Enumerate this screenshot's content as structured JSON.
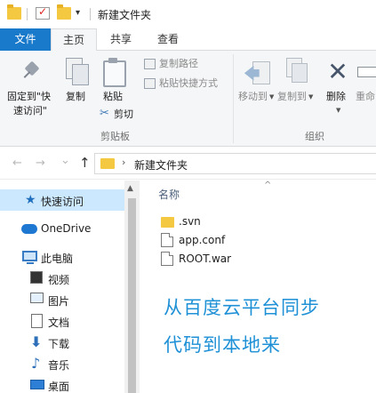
{
  "window": {
    "title": "新建文件夹",
    "qa_dropdown": "▾"
  },
  "ribbon_tabs": {
    "file": "文件",
    "home": "主页",
    "share": "共享",
    "view": "查看"
  },
  "ribbon": {
    "clipboard": {
      "group_label": "剪贴板",
      "pin_line1": "固定到\"快",
      "pin_line2": "速访问\"",
      "copy": "复制",
      "paste": "粘贴",
      "copy_path": "复制路径",
      "paste_shortcut": "粘贴快捷方式",
      "cut": "剪切"
    },
    "organize": {
      "group_label": "组织",
      "move_to": "移动到",
      "copy_to": "复制到",
      "delete": "删除",
      "rename": "重命"
    }
  },
  "address": {
    "back": "←",
    "forward": "→",
    "recent": "⌄",
    "up": "↑",
    "chevron": "›",
    "path": "新建文件夹"
  },
  "nav_pane": {
    "items": [
      {
        "label": "快速访问",
        "icon": "pin-icon"
      },
      {
        "label": "OneDrive",
        "icon": "cloud-icon"
      },
      {
        "label": "此电脑",
        "icon": "computer-icon"
      },
      {
        "label": "视频",
        "icon": "video-icon"
      },
      {
        "label": "图片",
        "icon": "pictures-icon"
      },
      {
        "label": "文档",
        "icon": "documents-icon"
      },
      {
        "label": "下载",
        "icon": "download-icon"
      },
      {
        "label": "音乐",
        "icon": "music-icon"
      },
      {
        "label": "桌面",
        "icon": "desktop-icon"
      }
    ]
  },
  "content": {
    "column_header": "名称",
    "sort_indicator": "^",
    "files": [
      {
        "name": ".svn",
        "type": "folder"
      },
      {
        "name": "app.conf",
        "type": "file"
      },
      {
        "name": "ROOT.war",
        "type": "file"
      }
    ],
    "overlay_line1": "从百度云平台同步",
    "overlay_line2": "代码到本地来",
    "overlay_color": "#1e90d6"
  },
  "colors": {
    "file_tab": "#1979ca",
    "selection": "#cce8ff",
    "folder": "#f5c842"
  }
}
